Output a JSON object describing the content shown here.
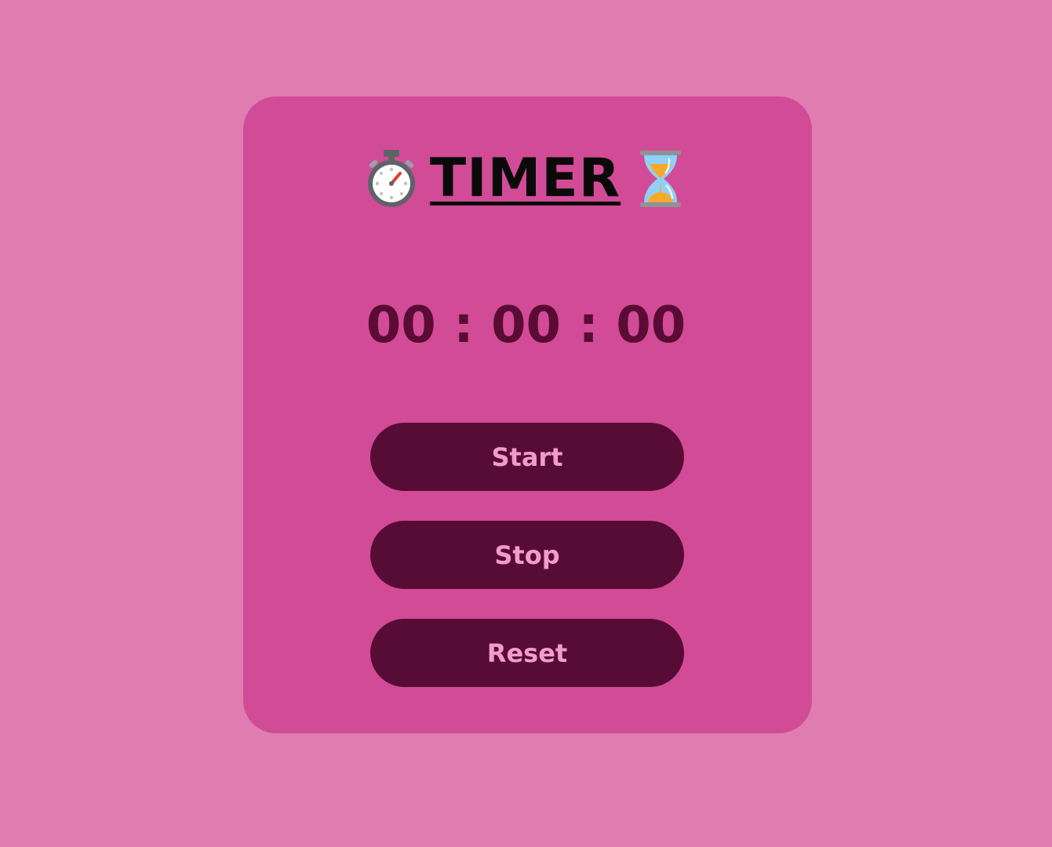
{
  "header": {
    "title": "TIMER",
    "left_icon": "stopwatch-icon",
    "right_icon": "hourglass-icon"
  },
  "timer": {
    "display": "00 : 00 : 00"
  },
  "controls": {
    "start_label": "Start",
    "stop_label": "Stop",
    "reset_label": "Reset"
  },
  "colors": {
    "page_background": "#df7db0",
    "card_background": "#d24b96",
    "display_text": "#5a0c35",
    "button_background": "#570c35",
    "button_text": "#f29ccb"
  }
}
